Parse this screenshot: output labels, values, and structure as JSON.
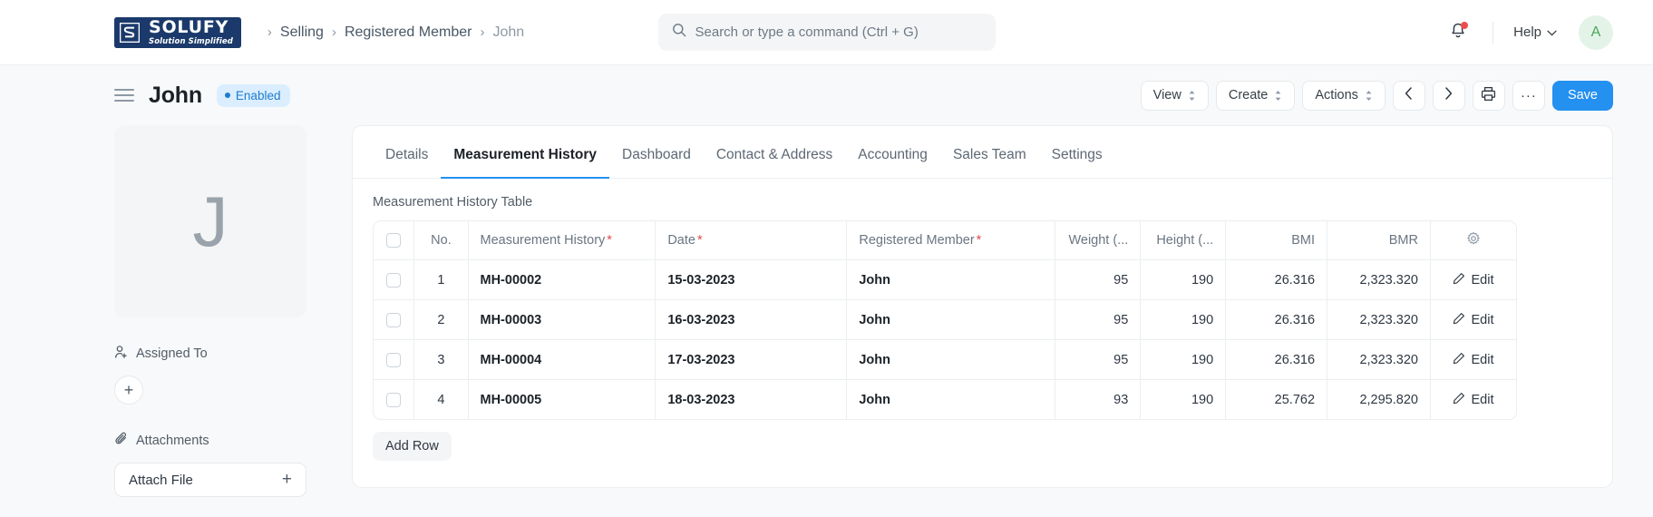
{
  "navbar": {
    "logo": {
      "title": "SOLUFY",
      "subtitle": "Solution Simplified",
      "mark_letter": "S"
    },
    "breadcrumb": {
      "sep": "›",
      "items": [
        {
          "label": "Selling",
          "current": false
        },
        {
          "label": "Registered Member",
          "current": false
        },
        {
          "label": "John",
          "current": true
        }
      ]
    },
    "search": {
      "placeholder": "Search or type a command (Ctrl + G)",
      "value": "",
      "icon": "search-icon"
    },
    "notifications": {
      "icon": "bell-icon",
      "has_unread": true,
      "badge_color": "#ef4d4d"
    },
    "help": {
      "label": "Help",
      "chevron": "⌄"
    },
    "avatar": {
      "initial": "A",
      "bg": "#e4f3e8",
      "fg": "#46a758"
    }
  },
  "page_header": {
    "menu_icon": "hamburger-icon",
    "title": "John",
    "status": {
      "label": "Enabled",
      "color": "#1f7ccc",
      "bg": "#daeeff"
    },
    "toolbar": {
      "view_label": "View",
      "create_label": "Create",
      "actions_label": "Actions",
      "prev_icon": "chevron-left-icon",
      "next_icon": "chevron-right-icon",
      "print_icon": "printer-icon",
      "more_label": "···",
      "save_label": "Save",
      "save_color": "#2490ef"
    }
  },
  "sidebar": {
    "avatar_letter": "J",
    "assigned_to": {
      "label": "Assigned To",
      "icon": "user-add-icon",
      "add_label": "+"
    },
    "attachments": {
      "label": "Attachments",
      "icon": "paperclip-icon",
      "attach_label": "Attach File",
      "add_label": "+"
    }
  },
  "main": {
    "tabs": [
      {
        "label": "Details",
        "active": false
      },
      {
        "label": "Measurement History",
        "active": true
      },
      {
        "label": "Dashboard",
        "active": false
      },
      {
        "label": "Contact & Address",
        "active": false
      },
      {
        "label": "Accounting",
        "active": false
      },
      {
        "label": "Sales Team",
        "active": false
      },
      {
        "label": "Settings",
        "active": false
      }
    ],
    "section_label": "Measurement History Table",
    "table": {
      "columns": [
        {
          "key": "checkbox",
          "label": "",
          "required": false
        },
        {
          "key": "no",
          "label": "No.",
          "required": false
        },
        {
          "key": "measurement_history",
          "label": "Measurement History",
          "required": true
        },
        {
          "key": "date",
          "label": "Date",
          "required": true
        },
        {
          "key": "registered_member",
          "label": "Registered Member",
          "required": true
        },
        {
          "key": "weight",
          "label": "Weight (...",
          "required": false
        },
        {
          "key": "height",
          "label": "Height (...",
          "required": false
        },
        {
          "key": "bmi",
          "label": "BMI",
          "required": false
        },
        {
          "key": "bmr",
          "label": "BMR",
          "required": false
        },
        {
          "key": "settings",
          "label": "",
          "required": false,
          "icon": "gear-icon"
        }
      ],
      "required_marker": "*",
      "rows": [
        {
          "no": "1",
          "measurement_history": "MH-00002",
          "date": "15-03-2023",
          "registered_member": "John",
          "weight": "95",
          "height": "190",
          "bmi": "26.316",
          "bmr": "2,323.320",
          "edit_label": "Edit"
        },
        {
          "no": "2",
          "measurement_history": "MH-00003",
          "date": "16-03-2023",
          "registered_member": "John",
          "weight": "95",
          "height": "190",
          "bmi": "26.316",
          "bmr": "2,323.320",
          "edit_label": "Edit"
        },
        {
          "no": "3",
          "measurement_history": "MH-00004",
          "date": "17-03-2023",
          "registered_member": "John",
          "weight": "95",
          "height": "190",
          "bmi": "26.316",
          "bmr": "2,323.320",
          "edit_label": "Edit"
        },
        {
          "no": "4",
          "measurement_history": "MH-00005",
          "date": "18-03-2023",
          "registered_member": "John",
          "weight": "93",
          "height": "190",
          "bmi": "25.762",
          "bmr": "2,295.820",
          "edit_label": "Edit"
        }
      ],
      "add_row_label": "Add Row"
    }
  }
}
